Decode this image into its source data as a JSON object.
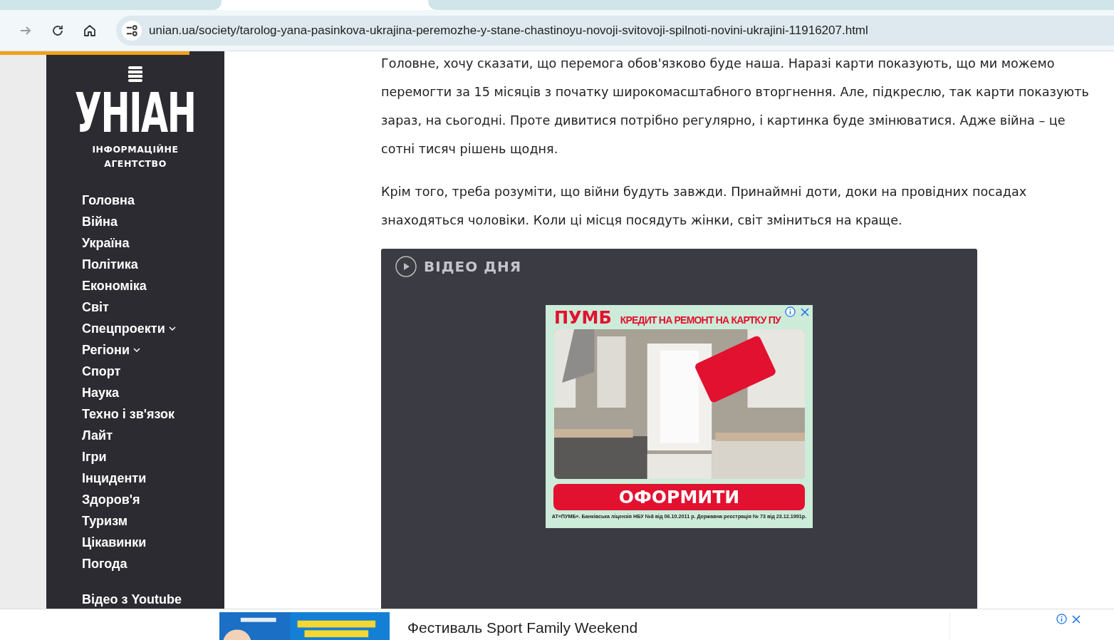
{
  "browser": {
    "url": "unian.ua/society/tarolog-yana-pasinkova-ukrajina-peremozhe-y-stane-chastinoyu-novoji-svitovoji-spilnoti-novini-ukrajini-11916207.html"
  },
  "logo": {
    "mark": "УНІАН",
    "tagline_1": "ІНФОРМАЦІЙНЕ",
    "tagline_2": "АГЕНТСТВО"
  },
  "menu": [
    {
      "label": "Головна",
      "has_submenu": false
    },
    {
      "label": "Війна",
      "has_submenu": false
    },
    {
      "label": "Україна",
      "has_submenu": false
    },
    {
      "label": "Політика",
      "has_submenu": false
    },
    {
      "label": "Економіка",
      "has_submenu": false
    },
    {
      "label": "Світ",
      "has_submenu": false
    },
    {
      "label": "Спецпроекти",
      "has_submenu": true
    },
    {
      "label": "Регіони",
      "has_submenu": true
    },
    {
      "label": "Спорт",
      "has_submenu": false
    },
    {
      "label": "Наука",
      "has_submenu": false
    },
    {
      "label": "Техно і зв'язок",
      "has_submenu": false
    },
    {
      "label": "Лайт",
      "has_submenu": false
    },
    {
      "label": "Ігри",
      "has_submenu": false
    },
    {
      "label": "Інциденти",
      "has_submenu": false
    },
    {
      "label": "Здоров'я",
      "has_submenu": false
    },
    {
      "label": "Туризм",
      "has_submenu": false
    },
    {
      "label": "Цікавинки",
      "has_submenu": false
    },
    {
      "label": "Погода",
      "has_submenu": false
    }
  ],
  "menu_extra": "Відео з Youtube",
  "article": {
    "paragraphs": [
      "Головне, хочу сказати, що перемога обов'язково буде наша. Наразі карти показують, що ми можемо перемогти за 15 місяців з початку широкомасштабного вторгнення. Але, підкреслю, так карти показують зараз, на сьогодні. Проте дивитися потрібно регулярно, і картинка буде змінюватися. Адже війна – це сотні тисяч рішень щодня.",
      "Крім того, треба розуміти, що війни будуть завжди. Принаймні доти, доки на провідних посадах знаходяться чоловіки. Коли ці місця посядуть жінки, світ зміниться на краще."
    ]
  },
  "video_block": {
    "title": "ВІДЕО ДНЯ",
    "ad": {
      "brand": "ПУМБ",
      "headline": "КРЕДИТ НА РЕМОНТ НА КАРТКУ ПУ",
      "button": "ОФОРМИТИ",
      "disclaimer": "АТ«ПУМБ». Банківська ліцензія НБУ №8 від 06.10.2011 р. Державна реєстрація № 73 від 23.12.1991р."
    }
  },
  "bottom_banner": {
    "title": "Фестиваль Sport Family Weekend"
  }
}
